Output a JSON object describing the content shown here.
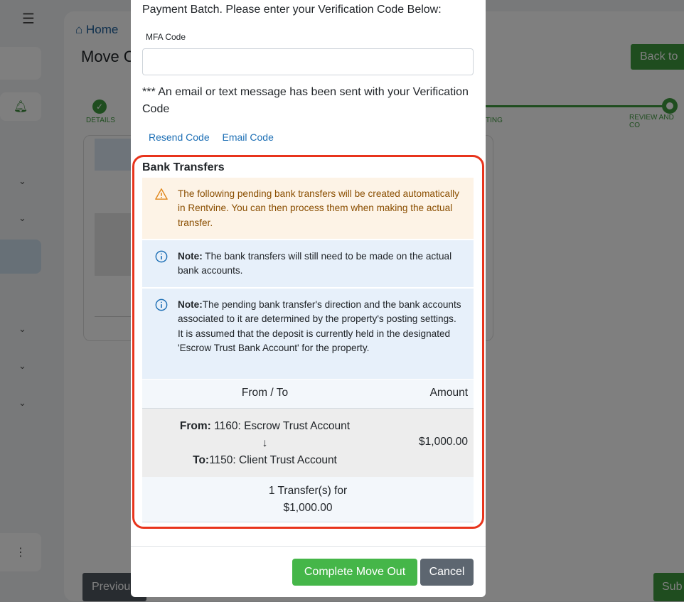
{
  "background": {
    "breadcrumb_home": "Home",
    "page_title": "Move O",
    "back_button": "Back to",
    "step_details": "DETAILS",
    "step_posting": "TING",
    "step_review": "REVIEW AND CO",
    "previous_button": "Previou",
    "submit_button": "Sub"
  },
  "modal": {
    "verify_text": "Payment Batch. Please enter your Verification Code Below:",
    "mfa_label": "MFA Code",
    "mfa_value": "",
    "sent_text": "*** An email or text message has been sent with your Verification Code",
    "resend_link": "Resend Code",
    "email_link": "Email Code",
    "bank_transfers_title": "Bank Transfers",
    "warning_text": "The following pending bank transfers will be created automatically in Rentvine. You can then process them when making the actual transfer.",
    "note1_label": "Note:",
    "note1_text": " The bank transfers will still need to be made on the actual bank accounts.",
    "note2_label": "Note:",
    "note2_text": "The pending bank transfer's direction and the bank accounts associated to it are determined by the property's posting settings. It is assumed that the deposit is currently held in the designated 'Escrow Trust Bank Account' for the property.",
    "table": {
      "col_from_to": "From / To",
      "col_amount": "Amount",
      "row": {
        "from_label": "From:",
        "from_value": " 1160: Escrow Trust Account",
        "arrow": "↓",
        "to_label": "To:",
        "to_value": "1150: Client Trust Account",
        "amount": "$1,000.00"
      },
      "summary_line1": "1 Transfer(s) for",
      "summary_line2": "$1,000.00"
    },
    "complete_button": "Complete Move Out",
    "cancel_button": "Cancel"
  },
  "colors": {
    "accent_green": "#45b649",
    "highlight_red": "#e8341c",
    "link_blue": "#1d6fb5"
  }
}
